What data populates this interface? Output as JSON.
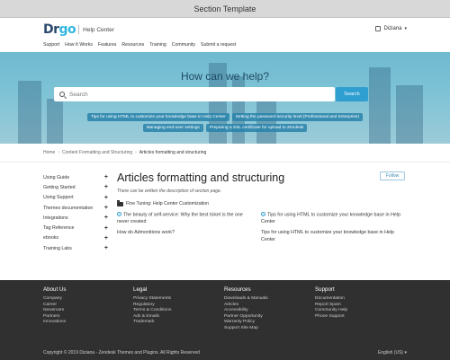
{
  "window": {
    "title": "Section Template"
  },
  "header": {
    "logo": {
      "part1": "Dr",
      "part2": "go"
    },
    "help_center": "Help Center",
    "user": "Diziana"
  },
  "nav": [
    "Support",
    "How It Works",
    "Features",
    "Resources",
    "Training",
    "Community",
    "Submit a request"
  ],
  "hero": {
    "title": "How can we help?",
    "search_placeholder": "Search",
    "search_button": "Search",
    "tags": [
      "Tips for using HTML to customize your knowledge base in Help Center",
      "Setting the password security level (Professional and Enterprise)",
      "Managing end-user settings",
      "Preparing a SSL certificate for upload to Zendesk"
    ]
  },
  "breadcrumb": [
    "Home",
    "Content Formatting and Structuring",
    "Articles formatting and structuring"
  ],
  "sidebar": [
    "Using Guide",
    "Getting Started",
    "Using Support",
    "Themes documentation",
    "Integrations",
    "Tag Reference",
    "ebooks",
    "Training Labs"
  ],
  "main": {
    "title": "Articles formatting and structuring",
    "follow": "Follow",
    "description": "There can be written the description of section page.",
    "section_label": "Fine Tuning: Help Center Customization",
    "articles": [
      "The beauty of self-service: Why the best ticket is the one never created",
      "Tips for using HTML to customize your knowledge base in Help Center",
      "How do Admonitions work?",
      "Tips for using HTML to customize your knowledge base in Help Center"
    ]
  },
  "footer": {
    "columns": [
      {
        "heading": "About Us",
        "links": [
          "Company",
          "Career",
          "Newsroom",
          "Partners",
          "Innovations"
        ]
      },
      {
        "heading": "Legal",
        "links": [
          "Privacy Statements",
          "Regulatory",
          "Terms & Conditions",
          "Ads & Emails",
          "Trademark"
        ]
      },
      {
        "heading": "Resources",
        "links": [
          "Downloads & Manuals",
          "Articles",
          "Accessibility",
          "Partner Opportunity",
          "Warranty Policy",
          "Support Site Map"
        ]
      },
      {
        "heading": "Support",
        "links": [
          "Documentation",
          "Report Spam",
          "Community Help",
          "Phone Support"
        ]
      }
    ],
    "copyright": "Copyright © 2019 Diziana - Zendesk Themes and Plugins. All Rights Reserved",
    "language": "English (US)"
  }
}
